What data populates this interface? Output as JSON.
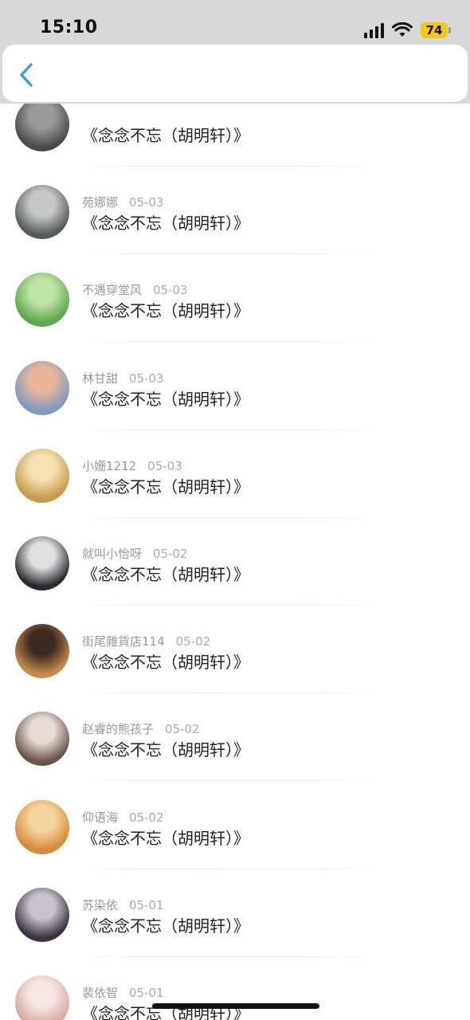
{
  "status": {
    "time": "15:10",
    "battery": "74"
  },
  "header": {
    "back_icon": "chevron-left-icon",
    "accent": "#2ea0e0"
  },
  "messages": [
    {
      "name": "",
      "date": "",
      "text": "《念念不忘（胡明轩）》",
      "avatar_colors": [
        "#4a4a4a",
        "#9a9a9a"
      ]
    },
    {
      "name": "苑娜娜",
      "date": "05-03",
      "text": "《念念不忘（胡明轩）》",
      "avatar_colors": [
        "#555a5a",
        "#c8c8c8"
      ]
    },
    {
      "name": "不遇穿堂风",
      "date": "05-03",
      "text": "《念念不忘（胡明轩）》",
      "avatar_colors": [
        "#5da84a",
        "#bfe3a8"
      ]
    },
    {
      "name": "林甘甜",
      "date": "05-03",
      "text": "《念念不忘（胡明轩）》",
      "avatar_colors": [
        "#7f9ac0",
        "#e8b59a"
      ]
    },
    {
      "name": "小姗1212",
      "date": "05-03",
      "text": "《念念不忘（胡明轩）》",
      "avatar_colors": [
        "#c79a4e",
        "#f3e2b0"
      ]
    },
    {
      "name": "就叫小怡呀",
      "date": "05-02",
      "text": "《念念不忘（胡明轩）》",
      "avatar_colors": [
        "#2a2a2e",
        "#e0e0e0"
      ]
    },
    {
      "name": "街尾雜貨店114",
      "date": "05-02",
      "text": "《念念不忘（胡明轩）》",
      "avatar_colors": [
        "#c88a4a",
        "#3a2a20"
      ]
    },
    {
      "name": "赵睿的熊孩子",
      "date": "05-02",
      "text": "《念念不忘（胡明轩）》",
      "avatar_colors": [
        "#6b5448",
        "#e6dcd6"
      ]
    },
    {
      "name": "仰语海",
      "date": "05-02",
      "text": "《念念不忘（胡明轩）》",
      "avatar_colors": [
        "#d58a3a",
        "#f5d6a0"
      ]
    },
    {
      "name": "苏染依",
      "date": "05-01",
      "text": "《念念不忘（胡明轩）》",
      "avatar_colors": [
        "#3a3440",
        "#c9c3cc"
      ]
    },
    {
      "name": "裴依智",
      "date": "05-01",
      "text": "《念念不忘（胡明轩）》",
      "avatar_colors": [
        "#d9a9a0",
        "#f6e6e2"
      ]
    }
  ]
}
